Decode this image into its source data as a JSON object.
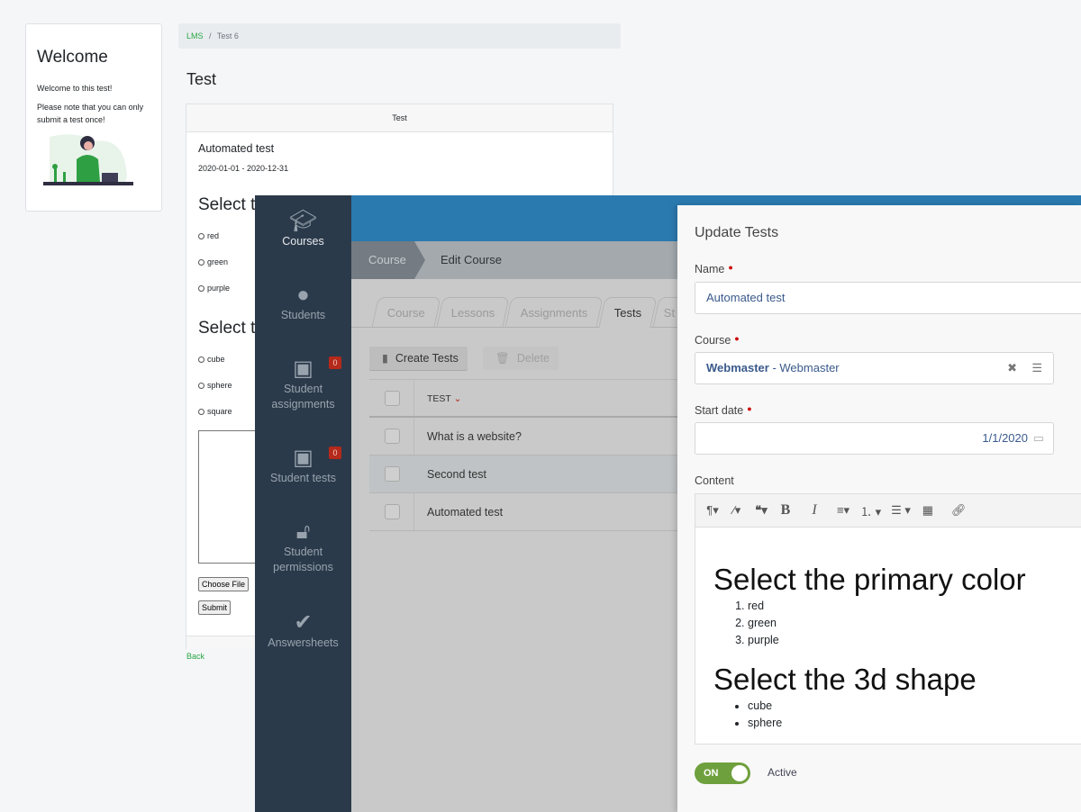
{
  "welcome": {
    "title": "Welcome",
    "line1": "Welcome to this test!",
    "line2": "Please note that you can only submit a test once!"
  },
  "breadcrumb": {
    "root": "LMS",
    "sep": "/",
    "current": "Test 6"
  },
  "page": {
    "title": "Test"
  },
  "test_card": {
    "header": "Test",
    "name": "Automated test",
    "dates": "2020-01-01 - 2020-12-31",
    "q1": "Select t",
    "q1_options": [
      "red",
      "green",
      "purple"
    ],
    "q2": "Select t",
    "q2_options": [
      "cube",
      "sphere",
      "square"
    ],
    "choose_file": "Choose File",
    "submit": "Submit",
    "back": "Back"
  },
  "sidebar": {
    "items": [
      {
        "label": "Courses",
        "icon": "graduation-cap-icon"
      },
      {
        "label": "Students",
        "icon": "user-icon"
      },
      {
        "label": "Student assignments",
        "icon": "inbox-icon",
        "badge": "0"
      },
      {
        "label": "Student tests",
        "icon": "inbox-icon",
        "badge": "0"
      },
      {
        "label": "Student permissions",
        "icon": "unlock-icon"
      },
      {
        "label": "Answersheets",
        "icon": "check-icon"
      }
    ]
  },
  "app_breadcrumb": {
    "parent": "Course",
    "current": "Edit Course"
  },
  "tabs": [
    "Course",
    "Lessons",
    "Assignments",
    "Tests",
    "St"
  ],
  "active_tab": "Tests",
  "toolbar": {
    "create": "Create Tests",
    "delete": "Delete"
  },
  "grid": {
    "column": "TEST",
    "rows": [
      "What is a website?",
      "Second test",
      "Automated test"
    ]
  },
  "modal": {
    "title": "Update Tests",
    "name_label": "Name",
    "name_value": "Automated test",
    "course_label": "Course",
    "course_value_bold": "Webmaster",
    "course_value_rest": " - Webmaster",
    "start_label": "Start date",
    "start_value": "1/1/2020",
    "content_label": "Content",
    "content": {
      "h1": "Select the primary color",
      "ol": [
        "red",
        "green",
        "purple"
      ],
      "h2": "Select the 3d shape",
      "ul": [
        "cube",
        "sphere"
      ]
    },
    "toggle": "ON",
    "toggle_label": "Active"
  },
  "colors": {
    "sidebar": "#2b3a4a",
    "topbar": "#2a7ab0",
    "toggle": "#6fa03e",
    "badge": "#b5291b",
    "link": "#28a745"
  }
}
